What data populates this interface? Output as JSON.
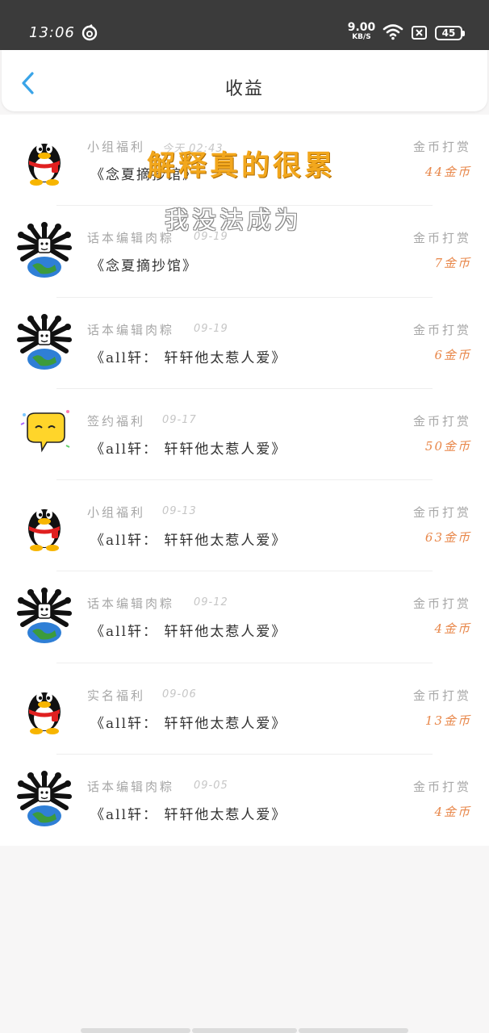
{
  "status_bar": {
    "time": "13:06",
    "net_speed_value": "9.00",
    "net_speed_unit": "KB/S",
    "battery": "45",
    "icons": [
      "netease-music-icon",
      "wifi-icon",
      "sim-icon",
      "battery-icon"
    ]
  },
  "header": {
    "title": "收益",
    "back_icon": "chevron-left-icon"
  },
  "overlay": {
    "line1": "解释真的很累",
    "line2": "我没法成为"
  },
  "colors": {
    "accent_back": "#3aa4e8",
    "amount": "#e8874a",
    "overlay_title": "#f2a71d",
    "status_bar": "#3b3b3b"
  },
  "records": [
    {
      "avatar": "qq-penguin",
      "label": "小组福利",
      "date": "今天 02:43",
      "book": "《念夏摘抄馆》",
      "type": "金币打赏",
      "amount": "44金币"
    },
    {
      "avatar": "globe-spider",
      "label": "话本编辑肉粽",
      "date": "09-19",
      "book": "《念夏摘抄馆》",
      "type": "金币打赏",
      "amount": "7金币"
    },
    {
      "avatar": "globe-spider",
      "label": "话本编辑肉粽",
      "date": "09-19",
      "book": "《all轩： 轩轩他太惹人爱》",
      "type": "金币打赏",
      "amount": "6金币"
    },
    {
      "avatar": "chat-bubble",
      "label": "签约福利",
      "date": "09-17",
      "book": "《all轩： 轩轩他太惹人爱》",
      "type": "金币打赏",
      "amount": "50金币"
    },
    {
      "avatar": "qq-penguin",
      "label": "小组福利",
      "date": "09-13",
      "book": "《all轩： 轩轩他太惹人爱》",
      "type": "金币打赏",
      "amount": "63金币"
    },
    {
      "avatar": "globe-spider",
      "label": "话本编辑肉粽",
      "date": "09-12",
      "book": "《all轩： 轩轩他太惹人爱》",
      "type": "金币打赏",
      "amount": "4金币"
    },
    {
      "avatar": "qq-penguin",
      "label": "实名福利",
      "date": "09-06",
      "book": "《all轩： 轩轩他太惹人爱》",
      "type": "金币打赏",
      "amount": "13金币"
    },
    {
      "avatar": "globe-spider",
      "label": "话本编辑肉粽",
      "date": "09-05",
      "book": "《all轩： 轩轩他太惹人爱》",
      "type": "金币打赏",
      "amount": "4金币"
    }
  ]
}
